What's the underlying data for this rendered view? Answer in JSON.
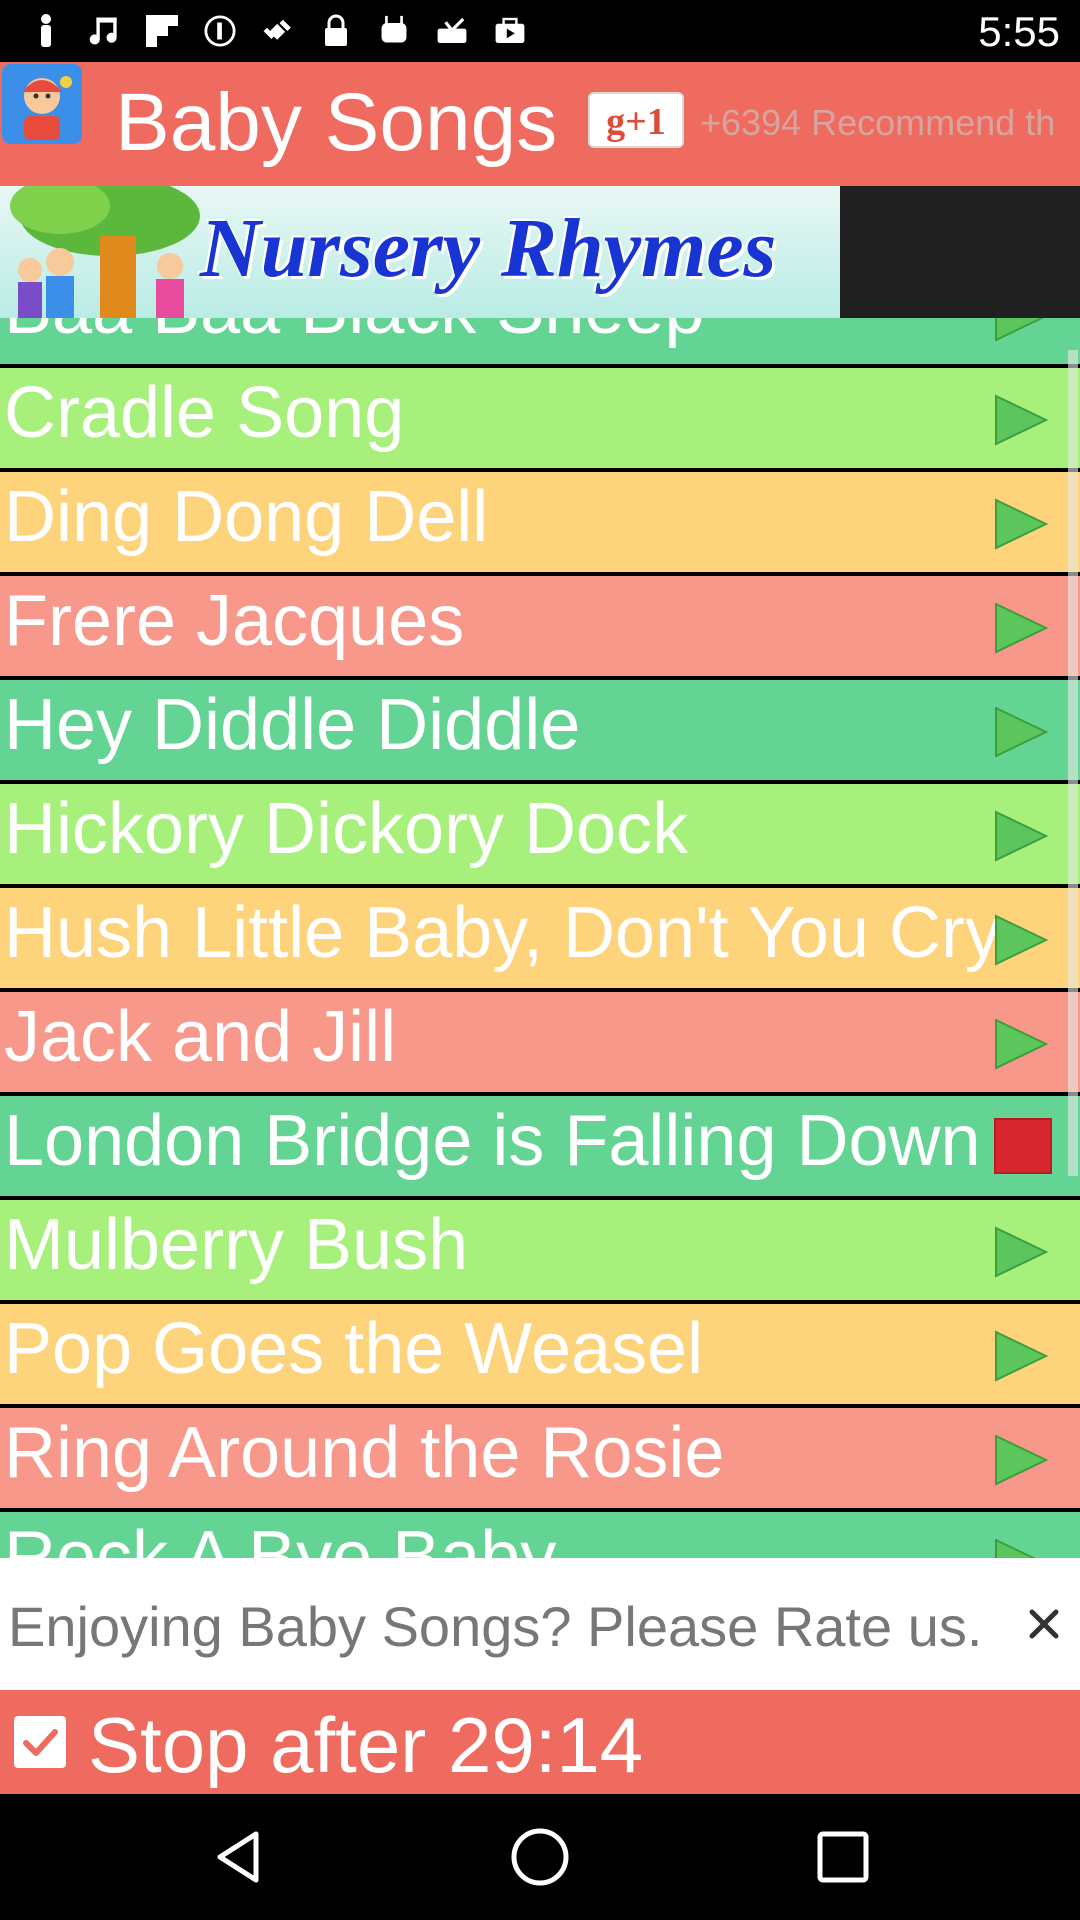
{
  "status_bar": {
    "time": "5:55",
    "icons": [
      "person-icon",
      "music-note-icon",
      "flipboard-icon",
      "rupee-coin-icon",
      "fake-gps-icon",
      "lock-icon",
      "android-icon",
      "download-tray-icon",
      "play-store-icon"
    ]
  },
  "header": {
    "title": "Baby Songs",
    "gplus_label": "g+1",
    "recommend_text": "+6394 Recommend th"
  },
  "banner": {
    "text": "Nursery Rhymes"
  },
  "songs": [
    {
      "name": "Baa Baa Black Sheep",
      "color": "#64d494",
      "state": "play"
    },
    {
      "name": "Cradle Song",
      "color": "#a8f07c",
      "state": "play"
    },
    {
      "name": "Ding Dong Dell",
      "color": "#fdd47c",
      "state": "play"
    },
    {
      "name": "Frere Jacques",
      "color": "#f8988a",
      "state": "play"
    },
    {
      "name": "Hey Diddle Diddle",
      "color": "#64d494",
      "state": "play"
    },
    {
      "name": "Hickory Dickory Dock",
      "color": "#a8f07c",
      "state": "play"
    },
    {
      "name": "Hush Little Baby, Don't You Cry",
      "color": "#fdd47c",
      "state": "play"
    },
    {
      "name": "Jack and Jill",
      "color": "#f8988a",
      "state": "play"
    },
    {
      "name": "London Bridge is Falling Down",
      "color": "#64d494",
      "state": "stop"
    },
    {
      "name": "Mulberry Bush",
      "color": "#a8f07c",
      "state": "play"
    },
    {
      "name": "Pop Goes the Weasel",
      "color": "#fdd47c",
      "state": "play"
    },
    {
      "name": "Ring Around the Rosie",
      "color": "#f8988a",
      "state": "play"
    },
    {
      "name": "Rock A Bye Baby",
      "color": "#64d494",
      "state": "play"
    }
  ],
  "rate_bar": {
    "text": "Enjoying Baby Songs? Please Rate us."
  },
  "stop_bar": {
    "label": "Stop after",
    "time": "29:14",
    "checked": true
  },
  "colors": {
    "header_bg": "#ef6b5f",
    "play_green": "#5cc65c"
  }
}
